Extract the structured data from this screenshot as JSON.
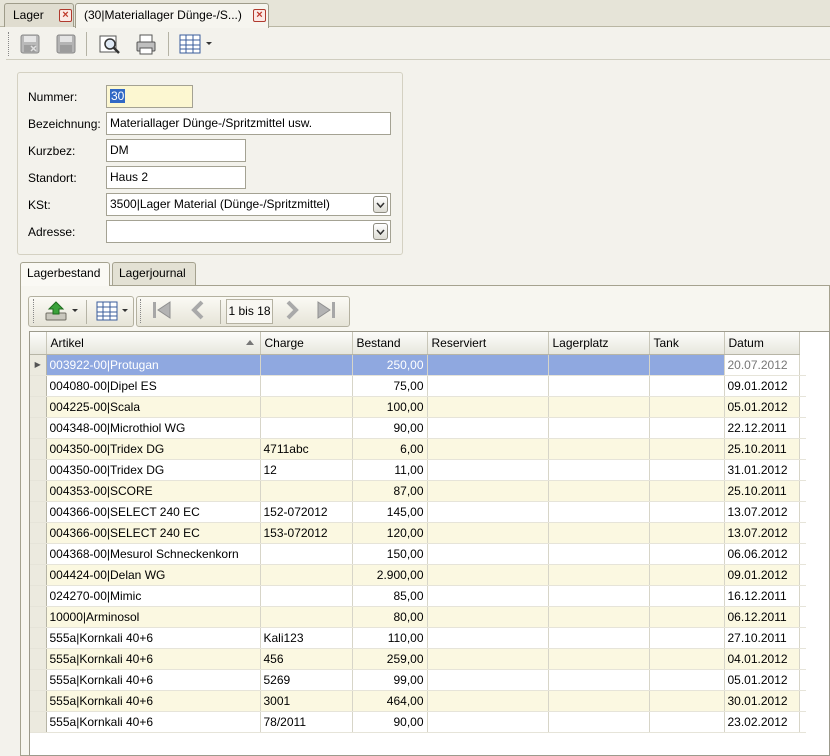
{
  "tabs": [
    {
      "label": "Lager",
      "active": false
    },
    {
      "label": "(30|Materiallager Dünge-/S...)",
      "active": true
    }
  ],
  "toolbar": {
    "icons": [
      "save-disabled-icon",
      "save-icon",
      "preview-icon",
      "print-icon",
      "grid-layout-icon"
    ]
  },
  "form": {
    "nummer": {
      "label": "Nummer:",
      "value": "30"
    },
    "bezeichnung": {
      "label": "Bezeichnung:",
      "value": "Materiallager Dünge-/Spritzmittel usw."
    },
    "kurzbez": {
      "label": "Kurzbez:",
      "value": "DM"
    },
    "standort": {
      "label": "Standort:",
      "value": "Haus 2"
    },
    "kst": {
      "label": "KSt:",
      "value": "3500|Lager Material (Dünge-/Spritzmittel)"
    },
    "adresse": {
      "label": "Adresse:",
      "value": ""
    }
  },
  "subtabs": [
    {
      "label": "Lagerbestand",
      "active": true
    },
    {
      "label": "Lagerjournal",
      "active": false
    }
  ],
  "pager": {
    "text": "1 bis 18"
  },
  "grid": {
    "columns": [
      "Artikel",
      "Charge",
      "Bestand",
      "Reserviert",
      "Lagerplatz",
      "Tank",
      "Datum"
    ],
    "rows": [
      [
        "003922-00|Protugan",
        "",
        "250,00",
        "",
        "",
        "",
        "20.07.2012"
      ],
      [
        "004080-00|Dipel ES",
        "",
        "75,00",
        "",
        "",
        "",
        "09.01.2012"
      ],
      [
        "004225-00|Scala",
        "",
        "100,00",
        "",
        "",
        "",
        "05.01.2012"
      ],
      [
        "004348-00|Microthiol WG",
        "",
        "90,00",
        "",
        "",
        "",
        "22.12.2011"
      ],
      [
        "004350-00|Tridex DG",
        "4711abc",
        "6,00",
        "",
        "",
        "",
        "25.10.2011"
      ],
      [
        "004350-00|Tridex DG",
        "12",
        "11,00",
        "",
        "",
        "",
        "31.01.2012"
      ],
      [
        "004353-00|SCORE",
        "",
        "87,00",
        "",
        "",
        "",
        "25.10.2011"
      ],
      [
        "004366-00|SELECT 240 EC",
        "152-072012",
        "145,00",
        "",
        "",
        "",
        "13.07.2012"
      ],
      [
        "004366-00|SELECT 240 EC",
        "153-072012",
        "120,00",
        "",
        "",
        "",
        "13.07.2012"
      ],
      [
        "004368-00|Mesurol Schneckenkorn",
        "",
        "150,00",
        "",
        "",
        "",
        "06.06.2012"
      ],
      [
        "004424-00|Delan  WG",
        "",
        "2.900,00",
        "",
        "",
        "",
        "09.01.2012"
      ],
      [
        "024270-00|Mimic",
        "",
        "85,00",
        "",
        "",
        "",
        "16.12.2011"
      ],
      [
        "10000|Arminosol",
        "",
        "80,00",
        "",
        "",
        "",
        "06.12.2011"
      ],
      [
        "555a|Kornkali 40+6",
        "Kali123",
        "110,00",
        "",
        "",
        "",
        "27.10.2011"
      ],
      [
        "555a|Kornkali 40+6",
        "456",
        "259,00",
        "",
        "",
        "",
        "04.01.2012"
      ],
      [
        "555a|Kornkali 40+6",
        "5269",
        "99,00",
        "",
        "",
        "",
        "05.01.2012"
      ],
      [
        "555a|Kornkali 40+6",
        "3001",
        "464,00",
        "",
        "",
        "",
        "30.01.2012"
      ],
      [
        "555a|Kornkali 40+6",
        "78/2011",
        "90,00",
        "",
        "",
        "",
        "23.02.2012"
      ]
    ]
  }
}
